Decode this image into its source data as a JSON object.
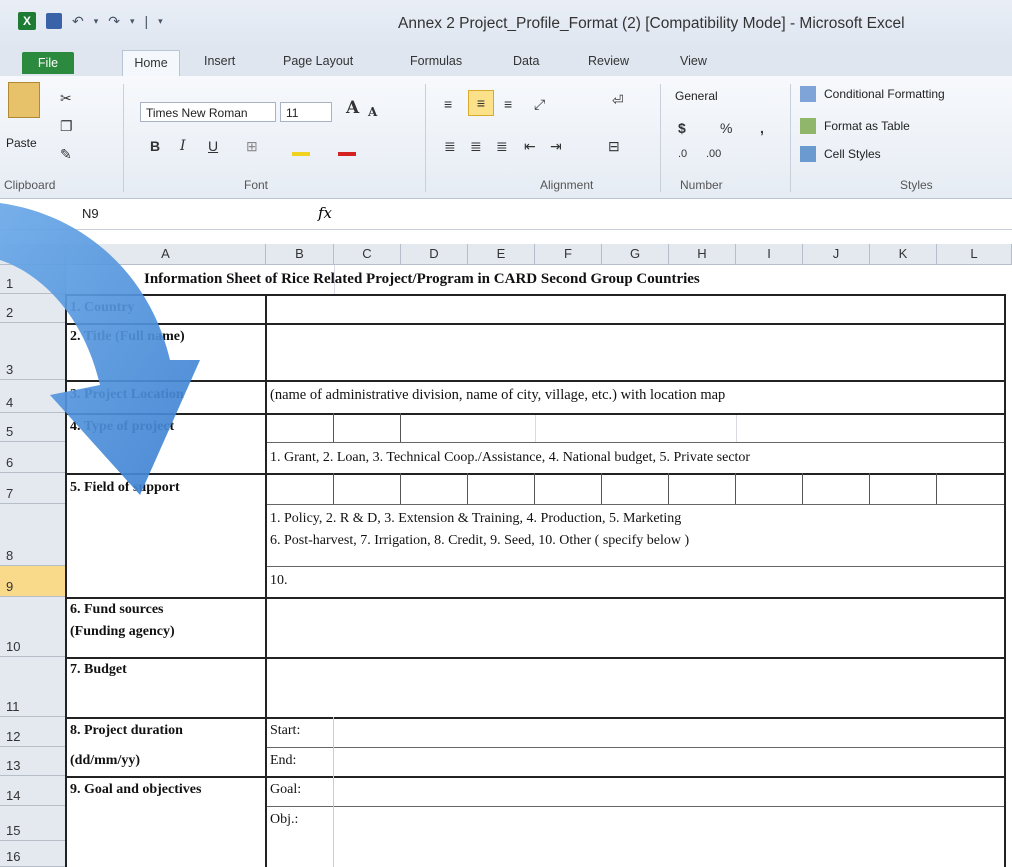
{
  "window": {
    "title": "Annex 2 Project_Profile_Format (2)  [Compatibility Mode]  -  Microsoft Excel",
    "app_icon": "X",
    "qat": {
      "undo": "↶",
      "undo_arrow": "▾",
      "redo": "↷",
      "redo_arrow": "▾",
      "separator": "|",
      "customize": "▾"
    }
  },
  "tabs": [
    "File",
    "Home",
    "Insert",
    "Page Layout",
    "Formulas",
    "Data",
    "Review",
    "View"
  ],
  "ribbon": {
    "clipboard": {
      "paste": "Paste",
      "label": "Clipboard"
    },
    "font": {
      "name": "Times New Roman",
      "size": "11",
      "grow": "A",
      "shrink": "A",
      "bold": "B",
      "italic": "I",
      "underline": "U",
      "label": "Font"
    },
    "alignment": {
      "label": "Alignment"
    },
    "number": {
      "format": "General",
      "currency": "$",
      "percent": "%",
      "comma": ",",
      "label": "Number"
    },
    "styles": {
      "conditional": "Conditional Formatting",
      "format_table": "Format as Table",
      "cell_styles": "Cell Styles",
      "label": "Styles"
    }
  },
  "formula_bar": {
    "namebox": "N9",
    "fx": "fx",
    "content": ""
  },
  "columns": [
    "A",
    "B",
    "C",
    "D",
    "E",
    "F",
    "G",
    "H",
    "I",
    "J",
    "K",
    "L"
  ],
  "rows": [
    "1",
    "2",
    "3",
    "4",
    "5",
    "6",
    "7",
    "8",
    "9",
    "10",
    "11",
    "12",
    "13",
    "14",
    "15",
    "16"
  ],
  "sheet": {
    "title": "Information Sheet of Rice Related Project/Program in CARD Second Group Countries",
    "country": "1. Country",
    "title_label": "2. Title",
    "title_label_2": "(Full name)",
    "location_label": "3. Project Location",
    "location_hint": "(name of administrative division, name of city, village, etc.) with location map",
    "type_label": "4. Type of project",
    "type_options": "1. Grant,  2. Loan, 3. Technical Coop./Assistance, 4. National budget, 5. Private sector",
    "field_label": "5. Field of support",
    "field_options_1": "1. Policy,  2. R & D,  3. Extension & Training,  4. Production,  5. Marketing",
    "field_options_2": "6. Post-harvest, 7. Irrigation, 8. Credit,  9. Seed,  10. Other (  specify below         )",
    "field_other": "10.",
    "fund_label_1": "6. Fund sources",
    "fund_label_2": "(Funding agency)",
    "budget_label": "7. Budget",
    "duration_label": "8. Project duration",
    "duration_format": "(dd/mm/yy)",
    "start": "Start:",
    "end": "End:",
    "goal_label": "9. Goal and objectives",
    "goal": "Goal:",
    "obj": "Obj.:"
  },
  "colors": {
    "accent": "#2b8a3e",
    "selected_row": "#f9d98a",
    "arrow": "#4a8fd8"
  }
}
